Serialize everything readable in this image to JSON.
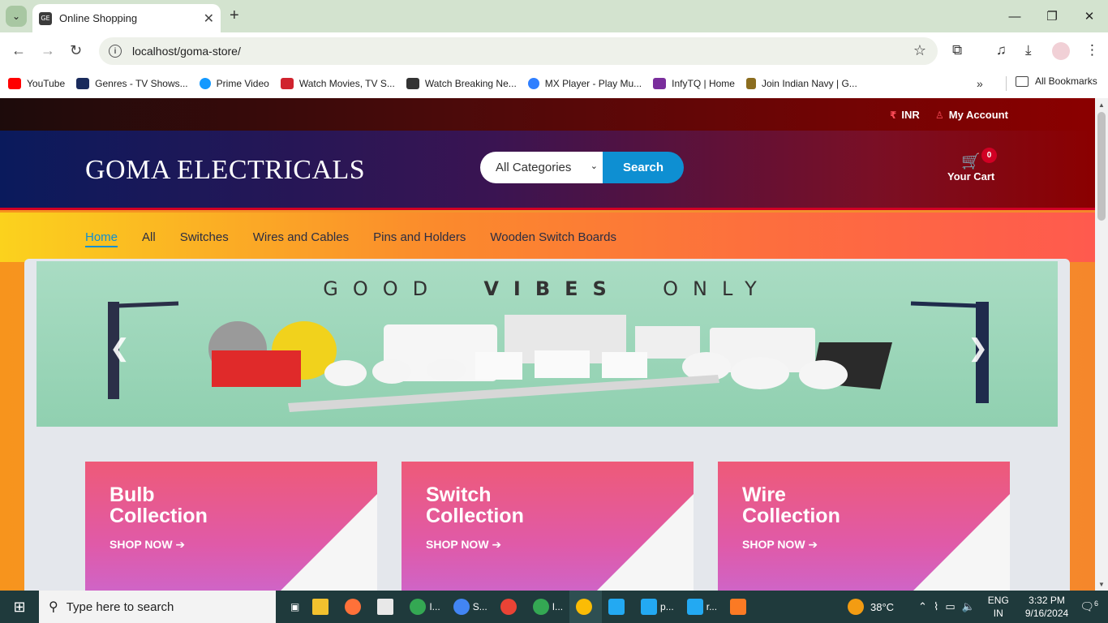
{
  "browser": {
    "tab_title": "Online Shopping",
    "url": "localhost/goma-store/",
    "bookmarks": [
      {
        "label": "YouTube",
        "color": "#ff0000"
      },
      {
        "label": "Genres - TV Shows...",
        "color": "#1a2b5c"
      },
      {
        "label": "Prime Video",
        "color": "#1399ff"
      },
      {
        "label": "Watch Movies, TV S...",
        "color": "#d0232e"
      },
      {
        "label": "Watch Breaking Ne...",
        "color": "#333333"
      },
      {
        "label": "MX Player - Play Mu...",
        "color": "#2f7fff"
      },
      {
        "label": "InfyTQ | Home",
        "color": "#7a2e9c"
      },
      {
        "label": "Join Indian Navy | G...",
        "color": "#8b6d1f"
      }
    ],
    "all_bookmarks": "All Bookmarks"
  },
  "store": {
    "currency": "INR",
    "account": "My Account",
    "brand": "GOMA ELECTRICALS",
    "search": {
      "category": "All Categories",
      "button": "Search"
    },
    "cart": {
      "label": "Your Cart",
      "count": "0"
    },
    "nav": [
      {
        "label": "Home",
        "active": true
      },
      {
        "label": "All"
      },
      {
        "label": "Switches"
      },
      {
        "label": "Wires and Cables"
      },
      {
        "label": "Pins and Holders"
      },
      {
        "label": "Wooden Switch Boards"
      }
    ],
    "banner": {
      "pre": "GOOD",
      "bold": "VIBES",
      "post": "ONLY"
    },
    "collections": [
      {
        "line1": "Bulb",
        "line2": "Collection",
        "cta": "SHOP NOW"
      },
      {
        "line1": "Switch",
        "line2": "Collection",
        "cta": "SHOP NOW"
      },
      {
        "line1": "Wire",
        "line2": "Collection",
        "cta": "SHOP NOW"
      }
    ]
  },
  "taskbar": {
    "search_placeholder": "Type here to search",
    "apps": [
      "I...",
      "S...",
      "",
      "I...",
      "",
      "",
      "p...",
      "r...",
      ""
    ],
    "weather": "38°C",
    "lang": "ENG",
    "region": "IN",
    "time": "3:32 PM",
    "date": "9/16/2024",
    "notifications": "6"
  }
}
